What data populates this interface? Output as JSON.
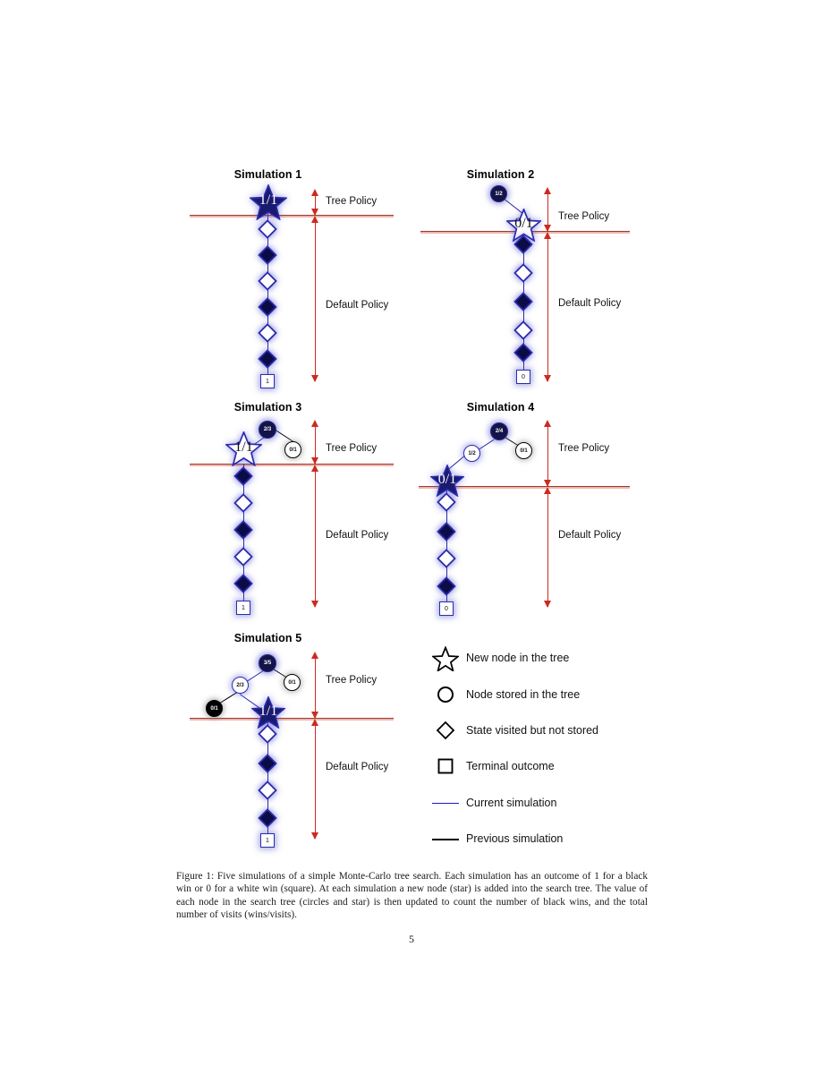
{
  "figure": {
    "simulations": [
      {
        "title": "Simulation 1",
        "nodes": [
          {
            "kind": "star",
            "style": "navy",
            "label": "1/1"
          }
        ],
        "circles": [],
        "chain": [
          "white",
          "black",
          "white",
          "black",
          "white",
          "black"
        ],
        "terminal": "1",
        "tree_policy_label": "Tree Policy",
        "default_policy_label": "Default Policy"
      },
      {
        "title": "Simulation 2",
        "nodes": [
          {
            "kind": "circle",
            "style": "navy",
            "label": "1/2"
          },
          {
            "kind": "star",
            "style": "white",
            "label": "0/1"
          }
        ],
        "chain": [
          "black",
          "white",
          "black",
          "white",
          "black"
        ],
        "terminal": "0",
        "tree_policy_label": "Tree Policy",
        "default_policy_label": "Default Policy"
      },
      {
        "title": "Simulation 3",
        "nodes": [
          {
            "kind": "circle",
            "style": "navy",
            "label": "2/3"
          },
          {
            "kind": "star",
            "style": "white",
            "label": "1/1"
          },
          {
            "kind": "circle",
            "style": "white-black",
            "label": "0/1"
          }
        ],
        "chain": [
          "black",
          "white",
          "black",
          "white",
          "black"
        ],
        "terminal": "1",
        "tree_policy_label": "Tree Policy",
        "default_policy_label": "Default Policy"
      },
      {
        "title": "Simulation 4",
        "nodes": [
          {
            "kind": "circle",
            "style": "navy",
            "label": "2/4"
          },
          {
            "kind": "circle",
            "style": "white-blue",
            "label": "1/2"
          },
          {
            "kind": "circle",
            "style": "white-black",
            "label": "0/1"
          },
          {
            "kind": "star",
            "style": "navy",
            "label": "0/1"
          }
        ],
        "chain": [
          "white",
          "black",
          "white",
          "black"
        ],
        "terminal": "0",
        "tree_policy_label": "Tree Policy",
        "default_policy_label": "Default Policy"
      },
      {
        "title": "Simulation 5",
        "nodes": [
          {
            "kind": "circle",
            "style": "navy",
            "label": "3/5"
          },
          {
            "kind": "circle",
            "style": "white-blue",
            "label": "2/3"
          },
          {
            "kind": "circle",
            "style": "white-black",
            "label": "0/1"
          },
          {
            "kind": "circle",
            "style": "black",
            "label": "0/1"
          },
          {
            "kind": "star",
            "style": "navy",
            "label": "1/1"
          }
        ],
        "chain": [
          "white",
          "black",
          "white",
          "black"
        ],
        "terminal": "1",
        "tree_policy_label": "Tree Policy",
        "default_policy_label": "Default Policy"
      }
    ],
    "legend": [
      {
        "icon": "star-outline-icon",
        "label": "New node in the tree"
      },
      {
        "icon": "circle-outline-icon",
        "label": "Node stored in the tree"
      },
      {
        "icon": "diamond-outline-icon",
        "label": "State visited but not stored"
      },
      {
        "icon": "square-outline-icon",
        "label": "Terminal outcome"
      },
      {
        "icon": "blue-line-icon",
        "label": "Current simulation"
      },
      {
        "icon": "black-line-icon",
        "label": "Previous simulation"
      }
    ]
  },
  "caption": {
    "text": "Figure 1: Five simulations of a simple Monte-Carlo tree search. Each simulation has an outcome of 1 for a black win or 0 for a white win (square). At each simulation a new node (star) is added into the search tree. The value of each node in the search tree (circles and star) is then updated to count the number of black wins, and the total number of visits (wins/visits)."
  },
  "page_number": "5",
  "colors": {
    "navy": "#131347",
    "blue_edge": "#2b2bad",
    "red_arrow": "#cc2a20",
    "maroon_line": "#9c3b2e",
    "black": "#000000"
  }
}
